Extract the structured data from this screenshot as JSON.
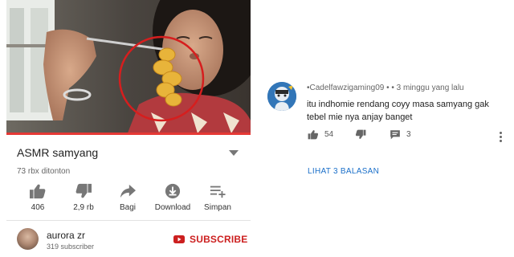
{
  "video": {
    "title": "ASMR samyang",
    "views": "73 rbx ditonton",
    "progress_fraction": 1.0
  },
  "actions": {
    "like": {
      "label": "406",
      "icon": "thumbs-up-icon"
    },
    "dislike": {
      "label": "2,9 rb",
      "icon": "thumbs-down-icon"
    },
    "share": {
      "label": "Bagi",
      "icon": "share-icon"
    },
    "download": {
      "label": "Download",
      "icon": "download-icon"
    },
    "save": {
      "label": "Simpan",
      "icon": "playlist-add-icon"
    }
  },
  "channel": {
    "name": "aurora zr",
    "subscribers": "319 subscriber",
    "subscribe_label": "SUBSCRIBE"
  },
  "comment": {
    "meta": "•Cadelfawzigaming09 • • 3 minggu yang lalu",
    "text": "itu indhomie rendang coyy masa samyang gak tebel mie nya anjay banget",
    "likes": "54",
    "replies_count": "3",
    "view_replies_label": "LIHAT 3 BALASAN"
  },
  "colors": {
    "accent_red": "#cc1f1f",
    "link_blue": "#1a6fc9",
    "progress_red": "#e53935"
  }
}
